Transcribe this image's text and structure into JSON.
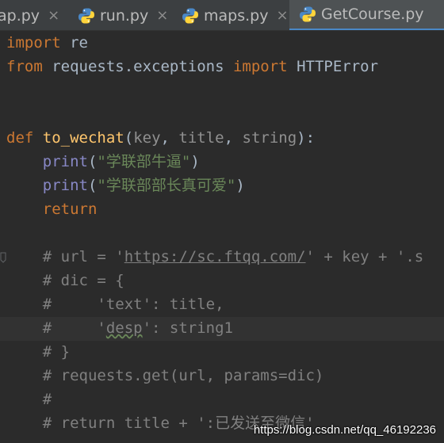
{
  "tabs": [
    {
      "name": "ap.py",
      "active": false
    },
    {
      "name": "run.py",
      "active": false
    },
    {
      "name": "maps.py",
      "active": false
    },
    {
      "name": "GetCourse.py",
      "active": true
    }
  ],
  "tab_close_glyph": "×",
  "icons": {
    "file": "python-file-icon",
    "close": "close-icon",
    "fold": "fold-marker-icon"
  },
  "colors": {
    "background": "#2b2b2b",
    "keyword": "#cc7832",
    "function": "#ffc66d",
    "builtin": "#8888c6",
    "string": "#6a8759",
    "comment": "#808080",
    "text": "#a9b7c6",
    "accent": "#4a88c7"
  },
  "code": {
    "l1": {
      "kw": "import",
      "rest": " re"
    },
    "l2": {
      "kw1": "from",
      "mod": " requests.exceptions ",
      "kw2": "import",
      "rest": " HTTPError"
    },
    "l5": {
      "kw": "def",
      "sp": " ",
      "fn": "to_wechat",
      "open": "(",
      "p1": "key",
      "c1": ", ",
      "p2": "title",
      "c2": ", ",
      "p3": "string",
      "close": "):"
    },
    "l6": {
      "indent": "    ",
      "bi": "print",
      "open": "(",
      "str": "\"学联部牛逼\"",
      "close": ")"
    },
    "l7": {
      "indent": "    ",
      "bi": "print",
      "open": "(",
      "str": "\"学联部部长真可爱\"",
      "close": ")"
    },
    "l8": {
      "indent": "    ",
      "kw": "return"
    },
    "l10": {
      "pre": "    # url = '",
      "link": "https://sc.ftqq.com/",
      "post": "' + key + '.s"
    },
    "l11": {
      "text": "    # dic = {"
    },
    "l12": {
      "text": "    #     'text': title,"
    },
    "l13": {
      "pre": "    #     '",
      "squig": "desp",
      "post": "': string1"
    },
    "l14": {
      "text": "    # }"
    },
    "l15": {
      "text": "    # requests.get(url, params=dic)"
    },
    "l16": {
      "text": "    #"
    },
    "l17": {
      "text": "    # return title + ':已发送至微信'"
    }
  },
  "watermark": "https://blog.csdn.net/qq_46192236"
}
